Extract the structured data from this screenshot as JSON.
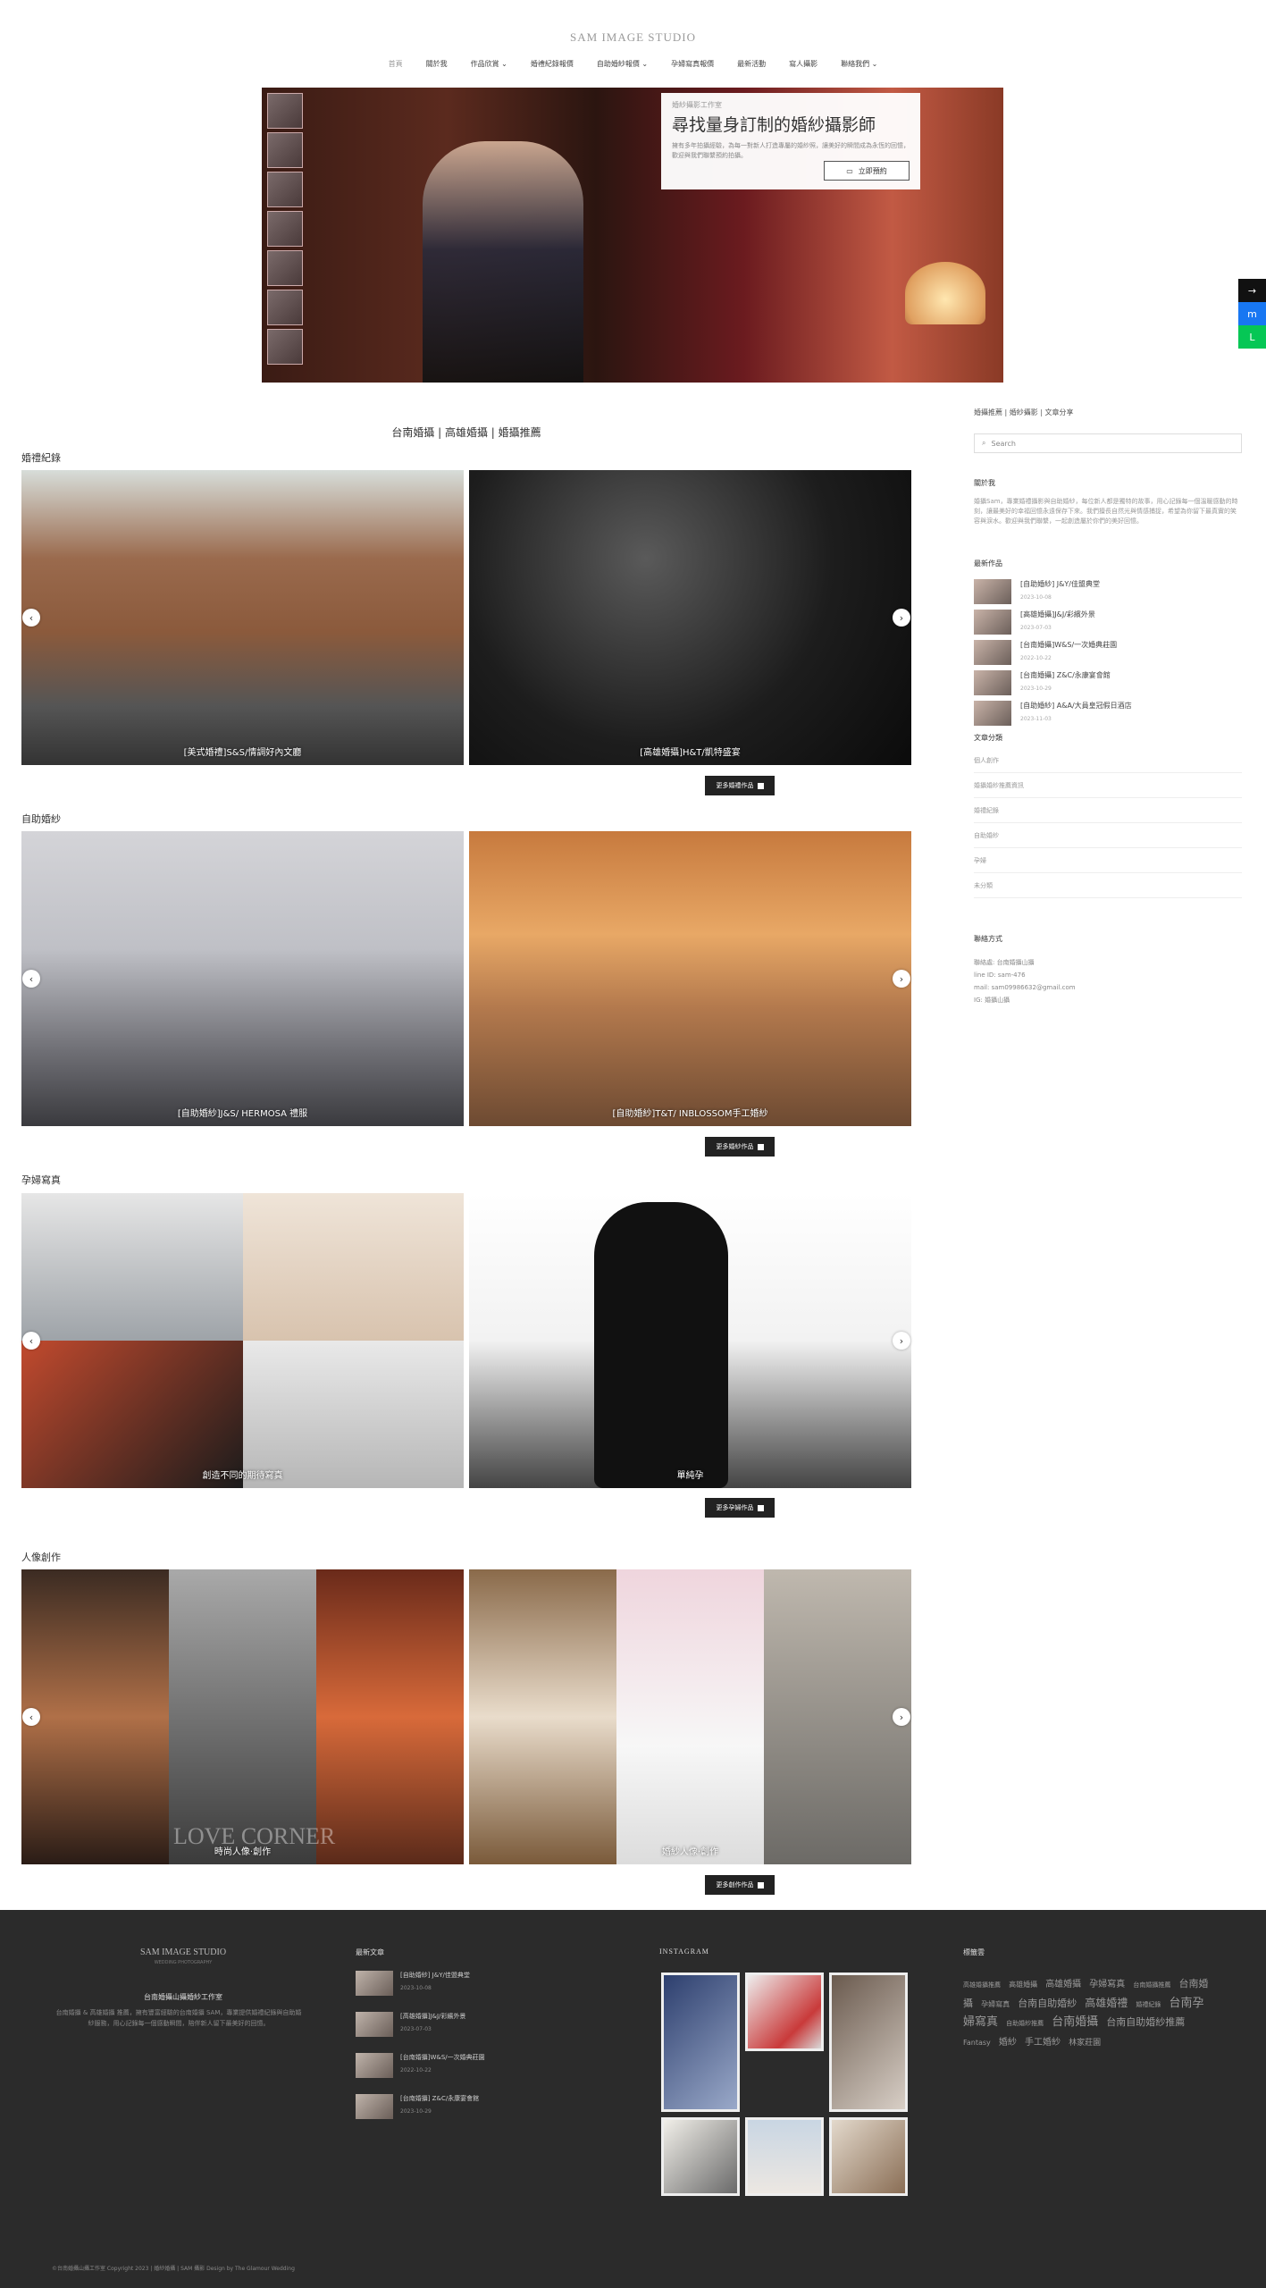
{
  "header": {
    "brand": "SAM IMAGE STUDIO",
    "nav": [
      {
        "label": "首頁",
        "active": true
      },
      {
        "label": "關於我"
      },
      {
        "label": "作品欣賞 ⌄"
      },
      {
        "label": "婚禮紀錄報價"
      },
      {
        "label": "自助婚紗報價 ⌄"
      },
      {
        "label": "孕婦寫真報價"
      },
      {
        "label": "最新活動"
      },
      {
        "label": "寫人攝影"
      },
      {
        "label": "聯絡我們 ⌄"
      }
    ]
  },
  "hero": {
    "kicker": "婚紗攝影工作室",
    "title": "尋找量身訂制的婚紗攝影師",
    "desc": "擁有多年拍攝經驗，為每一對新人打造專屬的婚紗照，讓美好的瞬間成為永恆的回憶，歡迎與我們聯繫預約拍攝。",
    "button": "立即預約"
  },
  "float_buttons": [
    "→",
    "m",
    "L"
  ],
  "main": {
    "heading": "台南婚攝 | 高雄婚攝 | 婚攝推薦",
    "categories": [
      {
        "title": "婚禮紀錄",
        "items": [
          "[美式婚禮]S&S/情調好內文廳",
          "[高雄婚攝]H&T/凱特盛宴"
        ],
        "more": "更多婚禮作品"
      },
      {
        "title": "自助婚紗",
        "items": [
          "[自助婚紗]J&S/ HERMOSA 禮服",
          "[自助婚紗]T&T/ INBLOSSOM手工婚紗"
        ],
        "more": "更多婚紗作品"
      },
      {
        "title": "孕婦寫真",
        "items": [
          "創造不同的期待寫真",
          "單純孕"
        ],
        "more": "更多孕婦作品"
      },
      {
        "title": "人像創作",
        "items": [
          "時尚人像·創作",
          "婚紗人像·創作"
        ],
        "more": "更多創作作品"
      }
    ],
    "portrait_watermark": "LOVE CORNER"
  },
  "sidebar": {
    "top_links": "婚攝推薦 | 婚紗攝影 | 文章分享",
    "search_placeholder": "Search",
    "about_title": "關於我",
    "about_text": "婚攝Sam，專業婚禮攝影與自助婚紗，每位新人都是獨特的故事，用心記錄每一個溫暖感動的時刻，讓最美好的幸福回憶永遠保存下來。我們擅長自然光與情感捕捉，希望為你留下最真實的笑容與淚水。歡迎與我們聯繫，一起創造屬於你們的美好回憶。",
    "recent_title": "最新作品",
    "recent": [
      {
        "title": "[自助婚紗] J&Y/佳盟典堂",
        "date": "2023-10-08"
      },
      {
        "title": "[高雄婚攝]J&J/彩繽外景",
        "date": "2023-07-03"
      },
      {
        "title": "[台南婚攝]W&S/一次婚典莊園",
        "date": "2022-10-22"
      },
      {
        "title": "[台南婚攝] Z&C/永康宴會館",
        "date": "2023-10-29"
      },
      {
        "title": "[自助婚紗] A&A/大員皇冠假日酒店",
        "date": "2023-11-03"
      }
    ],
    "cat_title": "文章分類",
    "cat_list": [
      "個人創作",
      "婚攝婚紗推薦資訊",
      "婚禮紀錄",
      "自助婚紗",
      "孕婦",
      "未分類"
    ],
    "contact_title": "聯絡方式",
    "contact": [
      "聯絡處: 台南婚攝山攝",
      "line ID: sam-476",
      "mail: sam09986632@gmail.com",
      "IG: 婚攝山攝"
    ]
  },
  "footer": {
    "brand": "SAM IMAGE STUDIO",
    "brand_sub": "WEDDING PHOTOGRAPHY",
    "name": "台南婚攝山攝婚紗工作室",
    "desc": "台南婚攝 & 高雄婚攝 推薦，擁有豐富經驗的台南婚攝 SAM，專業提供婚禮紀錄與自助婚紗服務，用心記錄每一個感動瞬間，陪伴新人留下最美好的回憶。",
    "latest_title": "最新文章",
    "latest": [
      {
        "title": "[自助婚紗] J&Y/佳盟典堂",
        "date": "2023-10-08"
      },
      {
        "title": "[高雄婚攝]J&J/彩繽外景",
        "date": "2023-07-03"
      },
      {
        "title": "[台南婚攝]W&S/一次婚典莊園",
        "date": "2022-10-22"
      },
      {
        "title": "[台南婚攝] Z&C/永康宴會館",
        "date": "2023-10-29"
      }
    ],
    "insta_title": "INSTAGRAM",
    "tags_title": "標籤雲",
    "tags": [
      {
        "text": "高雄婚攝推薦",
        "size": 7
      },
      {
        "text": "高雄婚攝",
        "size": 8
      },
      {
        "text": "高雄婚攝",
        "size": 10
      },
      {
        "text": "孕婦寫真",
        "size": 10
      },
      {
        "text": "台南婚攝推薦",
        "size": 7
      },
      {
        "text": "台南婚攝",
        "size": 11
      },
      {
        "text": "孕婦寫真",
        "size": 8
      },
      {
        "text": "台南自助婚紗",
        "size": 11
      },
      {
        "text": "高雄婚禮",
        "size": 12
      },
      {
        "text": "婚禮紀錄",
        "size": 7
      },
      {
        "text": "台南孕婦寫真",
        "size": 13
      },
      {
        "text": "自助婚紗推薦",
        "size": 7
      },
      {
        "text": "台南婚攝",
        "size": 13
      },
      {
        "text": "台南自助婚紗推薦",
        "size": 11
      },
      {
        "text": "Fantasy",
        "size": 8
      },
      {
        "text": "婚紗",
        "size": 10
      },
      {
        "text": "手工婚紗",
        "size": 10
      },
      {
        "text": "林家莊園",
        "size": 9
      }
    ],
    "copyright": "©台南婚攝山攝工作室 Copyright 2023 | 婚紗婚攝 | SAM 攝影 Design by The Glamour Wedding"
  }
}
